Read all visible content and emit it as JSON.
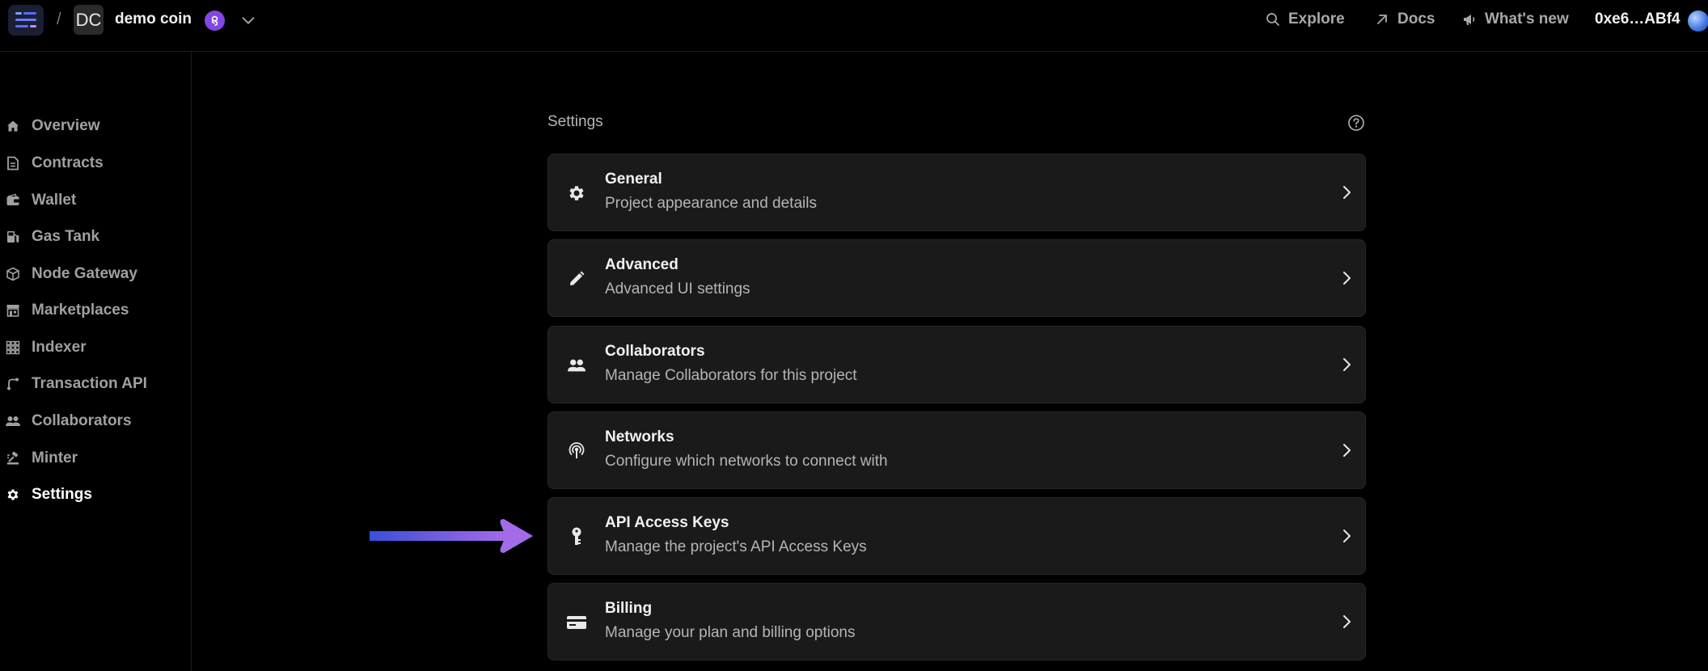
{
  "topbar": {
    "separator": "/",
    "project_initials": "DC",
    "project_name": "demo coin",
    "chain_icon": "polygon-icon",
    "nav": [
      {
        "label": "Explore",
        "icon": "search-icon"
      },
      {
        "label": "Docs",
        "icon": "external-link-icon"
      },
      {
        "label": "What's new",
        "icon": "megaphone-icon"
      }
    ],
    "wallet_address": "0xe6…ABf4"
  },
  "sidebar": {
    "items": [
      {
        "label": "Overview",
        "icon": "home-icon"
      },
      {
        "label": "Contracts",
        "icon": "document-icon"
      },
      {
        "label": "Wallet",
        "icon": "wallet-icon"
      },
      {
        "label": "Gas Tank",
        "icon": "gas-pump-icon"
      },
      {
        "label": "Node Gateway",
        "icon": "cube-icon"
      },
      {
        "label": "Marketplaces",
        "icon": "store-icon"
      },
      {
        "label": "Indexer",
        "icon": "grid-icon"
      },
      {
        "label": "Transaction API",
        "icon": "route-icon"
      },
      {
        "label": "Collaborators",
        "icon": "people-icon"
      },
      {
        "label": "Minter",
        "icon": "minter-icon"
      },
      {
        "label": "Settings",
        "icon": "gear-icon",
        "active": true
      }
    ]
  },
  "main": {
    "title": "Settings",
    "cards": [
      {
        "title": "General",
        "description": "Project appearance and details",
        "icon": "gear-icon"
      },
      {
        "title": "Advanced",
        "description": "Advanced UI settings",
        "icon": "pencil-icon"
      },
      {
        "title": "Collaborators",
        "description": "Manage Collaborators for this project",
        "icon": "people-icon"
      },
      {
        "title": "Networks",
        "description": "Configure which networks to connect with",
        "icon": "broadcast-icon"
      },
      {
        "title": "API Access Keys",
        "description": "Manage the project's API Access Keys",
        "icon": "key-icon"
      },
      {
        "title": "Billing",
        "description": "Manage your plan and billing options",
        "icon": "credit-card-icon"
      }
    ]
  },
  "colors": {
    "background": "#000000",
    "card": "#1a1a1a",
    "accent_purple": "#8247e5",
    "arrow_start": "#3b4fd8",
    "arrow_end": "#a46be8"
  }
}
